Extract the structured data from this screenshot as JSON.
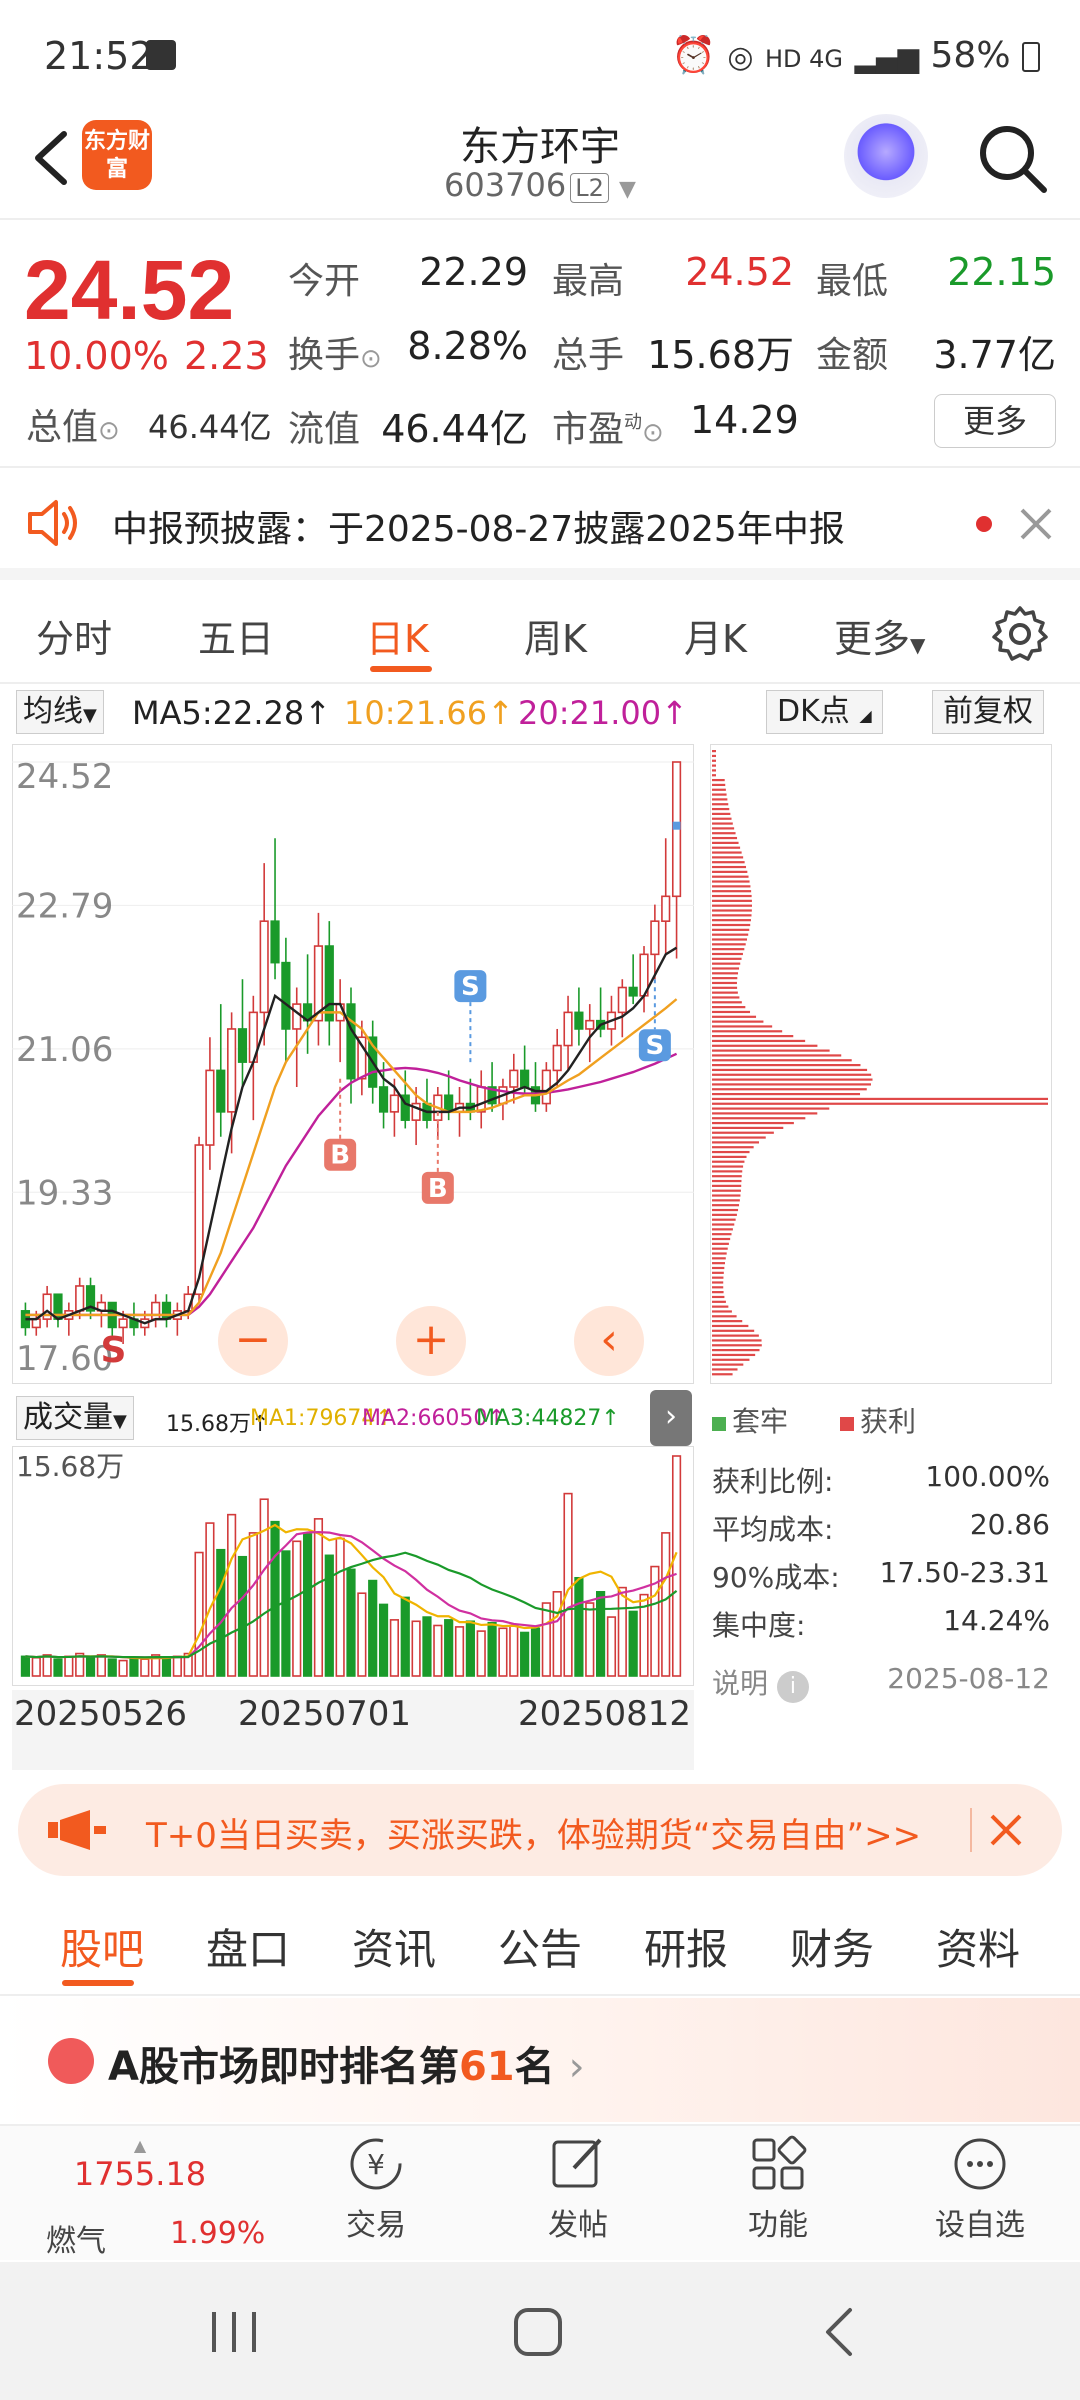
{
  "status_bar": {
    "time": "21:52",
    "network": "HD 4G",
    "battery": "58%"
  },
  "header": {
    "logo_text": "东方财富",
    "title": "东方环宇",
    "code": "603706",
    "level": "L2"
  },
  "quote": {
    "price": "24.52",
    "change_pct": "10.00%",
    "change": "2.23",
    "total_value_label": "总值",
    "total_value": "46.44亿",
    "rows": [
      [
        {
          "label": "今开",
          "value": "22.29",
          "color": "#222"
        },
        {
          "label": "最高",
          "value": "24.52",
          "color": "#e03030"
        },
        {
          "label": "最低",
          "value": "22.15",
          "color": "#1a9a2a"
        }
      ],
      [
        {
          "label": "换手",
          "value": "8.28%",
          "color": "#222"
        },
        {
          "label": "总手",
          "value": "15.68万",
          "color": "#222"
        },
        {
          "label": "金额",
          "value": "3.77亿",
          "color": "#222"
        }
      ],
      [
        {
          "label": "流值",
          "value": "46.44亿",
          "color": "#222"
        },
        {
          "label": "市盈",
          "value": "14.29",
          "color": "#222"
        }
      ]
    ],
    "pe_superscript": "动",
    "more": "更多"
  },
  "notice": {
    "text": "中报预披露：于2025-08-27披露2025年中报"
  },
  "ktabs": [
    "分时",
    "五日",
    "日K",
    "周K",
    "月K",
    "更多"
  ],
  "ktab_active": 2,
  "ma_bar": {
    "selector": "均线",
    "ma5": "MA5:22.28↑",
    "ma10": "10:21.66↑",
    "ma20": "20:21.00↑",
    "ma5_color": "#222",
    "ma10_color": "#f0a020",
    "ma20_color": "#c0209a",
    "dk_button": "DK点",
    "adjust_button": "前复权"
  },
  "chart_data": {
    "type": "candlestick",
    "y_ticks": [
      "24.52",
      "22.79",
      "21.06",
      "19.33",
      "17.60"
    ],
    "ylim": [
      17.5,
      24.52
    ],
    "markers": [
      "S",
      "B",
      "B",
      "S",
      "S"
    ],
    "candles": [
      [
        17.9,
        18.0,
        17.6,
        17.7
      ],
      [
        17.7,
        17.9,
        17.6,
        17.8
      ],
      [
        17.8,
        18.2,
        17.7,
        18.1
      ],
      [
        18.1,
        18.1,
        17.7,
        17.8
      ],
      [
        17.8,
        18.0,
        17.6,
        17.9
      ],
      [
        17.9,
        18.3,
        17.8,
        18.2
      ],
      [
        18.2,
        18.3,
        17.8,
        17.9
      ],
      [
        17.9,
        18.1,
        17.7,
        18.0
      ],
      [
        18.0,
        18.0,
        17.6,
        17.7
      ],
      [
        17.7,
        17.9,
        17.5,
        17.8
      ],
      [
        17.8,
        18.0,
        17.6,
        17.7
      ],
      [
        17.7,
        17.9,
        17.6,
        17.8
      ],
      [
        17.8,
        18.1,
        17.7,
        18.0
      ],
      [
        18.0,
        18.1,
        17.7,
        17.8
      ],
      [
        17.8,
        18.0,
        17.6,
        17.9
      ],
      [
        17.9,
        18.2,
        17.8,
        18.1
      ],
      [
        18.1,
        20.0,
        18.0,
        19.9
      ],
      [
        19.9,
        21.2,
        19.6,
        20.8
      ],
      [
        20.8,
        21.6,
        20.0,
        20.3
      ],
      [
        20.3,
        21.5,
        19.8,
        21.3
      ],
      [
        21.3,
        21.9,
        20.6,
        20.9
      ],
      [
        20.9,
        21.7,
        20.2,
        21.5
      ],
      [
        21.5,
        23.3,
        21.1,
        22.6
      ],
      [
        22.6,
        23.6,
        21.9,
        22.1
      ],
      [
        22.1,
        22.4,
        20.9,
        21.3
      ],
      [
        21.3,
        21.8,
        20.6,
        21.6
      ],
      [
        21.6,
        22.2,
        21.0,
        21.4
      ],
      [
        21.4,
        22.7,
        21.1,
        22.3
      ],
      [
        22.3,
        22.6,
        21.1,
        21.4
      ],
      [
        21.4,
        21.9,
        20.9,
        21.6
      ],
      [
        21.6,
        21.8,
        20.4,
        20.7
      ],
      [
        20.7,
        21.4,
        20.5,
        21.2
      ],
      [
        21.2,
        21.4,
        20.4,
        20.6
      ],
      [
        20.6,
        20.9,
        20.1,
        20.3
      ],
      [
        20.3,
        20.7,
        20.0,
        20.5
      ],
      [
        20.5,
        20.8,
        20.1,
        20.2
      ],
      [
        20.2,
        20.6,
        19.9,
        20.4
      ],
      [
        20.4,
        20.7,
        20.1,
        20.2
      ],
      [
        20.2,
        20.6,
        20.0,
        20.5
      ],
      [
        20.5,
        20.8,
        20.2,
        20.3
      ],
      [
        20.3,
        20.6,
        20.0,
        20.4
      ],
      [
        20.4,
        20.7,
        20.2,
        20.3
      ],
      [
        20.3,
        20.8,
        20.1,
        20.6
      ],
      [
        20.6,
        20.9,
        20.3,
        20.4
      ],
      [
        20.4,
        20.7,
        20.2,
        20.6
      ],
      [
        20.6,
        21.0,
        20.4,
        20.8
      ],
      [
        20.8,
        21.1,
        20.5,
        20.6
      ],
      [
        20.6,
        20.9,
        20.3,
        20.4
      ],
      [
        20.4,
        20.9,
        20.3,
        20.8
      ],
      [
        20.8,
        21.3,
        20.6,
        21.1
      ],
      [
        21.1,
        21.7,
        20.8,
        21.5
      ],
      [
        21.5,
        21.8,
        21.1,
        21.3
      ],
      [
        21.3,
        21.6,
        20.9,
        21.4
      ],
      [
        21.4,
        21.8,
        21.2,
        21.3
      ],
      [
        21.3,
        21.7,
        21.1,
        21.5
      ],
      [
        21.5,
        21.9,
        21.2,
        21.8
      ],
      [
        21.8,
        22.2,
        21.6,
        21.7
      ],
      [
        21.7,
        22.3,
        21.5,
        22.2
      ],
      [
        22.2,
        22.8,
        21.9,
        22.6
      ],
      [
        22.6,
        23.6,
        22.2,
        22.9
      ],
      [
        22.9,
        24.52,
        22.15,
        24.52
      ]
    ],
    "ma5": [
      17.8,
      17.8,
      17.9,
      17.8,
      17.85,
      17.9,
      17.95,
      17.9,
      17.9,
      17.85,
      17.8,
      17.75,
      17.8,
      17.8,
      17.85,
      17.9,
      18.3,
      18.9,
      19.5,
      20.1,
      20.6,
      20.9,
      21.3,
      21.7,
      21.6,
      21.5,
      21.4,
      21.5,
      21.6,
      21.6,
      21.3,
      21.1,
      20.9,
      20.7,
      20.6,
      20.4,
      20.35,
      20.3,
      20.3,
      20.3,
      20.35,
      20.35,
      20.4,
      20.45,
      20.5,
      20.55,
      20.6,
      20.55,
      20.55,
      20.65,
      20.8,
      21.0,
      21.2,
      21.35,
      21.4,
      21.45,
      21.55,
      21.7,
      21.95,
      22.2,
      22.28
    ],
    "ma10": [
      17.85,
      17.85,
      17.85,
      17.85,
      17.85,
      17.85,
      17.85,
      17.85,
      17.85,
      17.85,
      17.85,
      17.85,
      17.85,
      17.85,
      17.85,
      17.85,
      18.0,
      18.3,
      18.6,
      19.0,
      19.4,
      19.8,
      20.2,
      20.6,
      20.9,
      21.1,
      21.3,
      21.5,
      21.5,
      21.5,
      21.4,
      21.3,
      21.1,
      20.95,
      20.8,
      20.65,
      20.5,
      20.4,
      20.35,
      20.3,
      20.3,
      20.3,
      20.32,
      20.35,
      20.4,
      20.45,
      20.5,
      20.5,
      20.52,
      20.6,
      20.68,
      20.75,
      20.85,
      20.95,
      21.05,
      21.15,
      21.25,
      21.35,
      21.45,
      21.55,
      21.66
    ],
    "ma20": [
      17.85,
      17.85,
      17.85,
      17.85,
      17.85,
      17.85,
      17.85,
      17.85,
      17.85,
      17.85,
      17.85,
      17.85,
      17.85,
      17.85,
      17.85,
      17.85,
      17.95,
      18.1,
      18.3,
      18.5,
      18.7,
      18.9,
      19.15,
      19.4,
      19.65,
      19.85,
      20.05,
      20.25,
      20.4,
      20.55,
      20.65,
      20.72,
      20.78,
      20.8,
      20.82,
      20.83,
      20.82,
      20.8,
      20.77,
      20.73,
      20.68,
      20.64,
      20.6,
      20.57,
      20.55,
      20.53,
      20.52,
      20.52,
      20.53,
      20.55,
      20.57,
      20.6,
      20.63,
      20.66,
      20.7,
      20.74,
      20.78,
      20.83,
      20.88,
      20.94,
      21.0
    ]
  },
  "chip_legend": {
    "trapped": "套牢",
    "profit": "获利"
  },
  "chip_stats": [
    {
      "label": "获利比例:",
      "value": "100.00%"
    },
    {
      "label": "平均成本:",
      "value": "20.86"
    },
    {
      "label": "90%成本:",
      "value": "17.50-23.31"
    },
    {
      "label": "集中度:",
      "value": "14.24%"
    }
  ],
  "chip_explain": "说明",
  "chip_date": "2025-08-12",
  "volume": {
    "selector": "成交量",
    "vol": "15.68万↑",
    "ma1": "MA1:79674↑",
    "ma2": "MA2:66050↑",
    "ma3": "MA3:44827↑",
    "top_label": "15.68万",
    "values": [
      1.4,
      1.3,
      1.5,
      1.2,
      1.4,
      1.6,
      1.3,
      1.5,
      1.2,
      1.1,
      1.3,
      1.2,
      1.5,
      1.3,
      1.4,
      1.6,
      8.8,
      10.9,
      9.0,
      11.5,
      8.5,
      10.2,
      12.6,
      11.0,
      8.9,
      9.6,
      10.1,
      11.2,
      8.6,
      9.8,
      7.6,
      5.9,
      6.8,
      5.1,
      4.0,
      5.6,
      3.9,
      4.2,
      3.6,
      4.0,
      3.5,
      3.9,
      3.2,
      3.8,
      3.4,
      3.6,
      3.1,
      3.4,
      5.2,
      6.0,
      13.0,
      7.0,
      5.2,
      6.0,
      4.2,
      6.3,
      4.6,
      5.8,
      7.8,
      10.2,
      15.68
    ],
    "x_labels": [
      "20250526",
      "20250701",
      "20250812"
    ]
  },
  "ad": {
    "text": "T+0当日买卖，买涨买跌，体验期货“交易自由”>>"
  },
  "subtabs": [
    "股吧",
    "盘口",
    "资讯",
    "公告",
    "研报",
    "财务",
    "资料"
  ],
  "rank": {
    "prefix": "A股市场即时排名第",
    "number": "61",
    "suffix": "名"
  },
  "bottom_bar": {
    "index_value": "1755.18",
    "index_name": "燃气",
    "index_pct": "1.99%",
    "items": [
      "交易",
      "发帖",
      "功能",
      "设自选"
    ]
  }
}
